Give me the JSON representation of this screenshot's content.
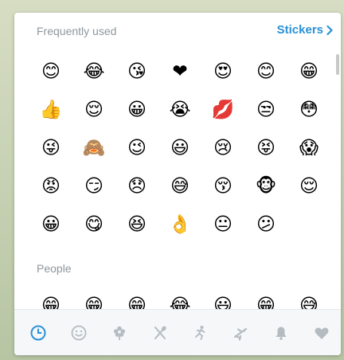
{
  "sections": {
    "frequent_title": "Frequently used",
    "stickers_label": "Stickers",
    "people_title": "People"
  },
  "frequent_emojis": [
    "😊",
    "😂",
    "😘",
    "❤",
    "😍",
    "😊",
    "😁",
    "👍",
    "😌",
    "😀",
    "😭",
    "💋",
    "😒",
    "😳",
    "😜",
    "🙈",
    "😉",
    "😃",
    "😢",
    "😝",
    "😱",
    "😡",
    "😏",
    "😞",
    "😅",
    "😚",
    "🐵",
    "😌",
    "😀",
    "😋",
    "😆",
    "👌",
    "😐",
    "😕"
  ],
  "people_emojis": [
    "😁",
    "😁",
    "😁",
    "😂",
    "😃",
    "😁",
    "😅"
  ],
  "tabs": [
    {
      "icon": "clock-icon",
      "active": true
    },
    {
      "icon": "smiley-icon",
      "active": false
    },
    {
      "icon": "flower-icon",
      "active": false
    },
    {
      "icon": "cutlery-icon",
      "active": false
    },
    {
      "icon": "runner-icon",
      "active": false
    },
    {
      "icon": "airplane-icon",
      "active": false
    },
    {
      "icon": "bell-icon",
      "active": false
    },
    {
      "icon": "heart-icon",
      "active": false
    }
  ],
  "colors": {
    "accent": "#2a91d6",
    "header_text": "#8e969c",
    "tab_inactive": "#b4bcc2"
  }
}
